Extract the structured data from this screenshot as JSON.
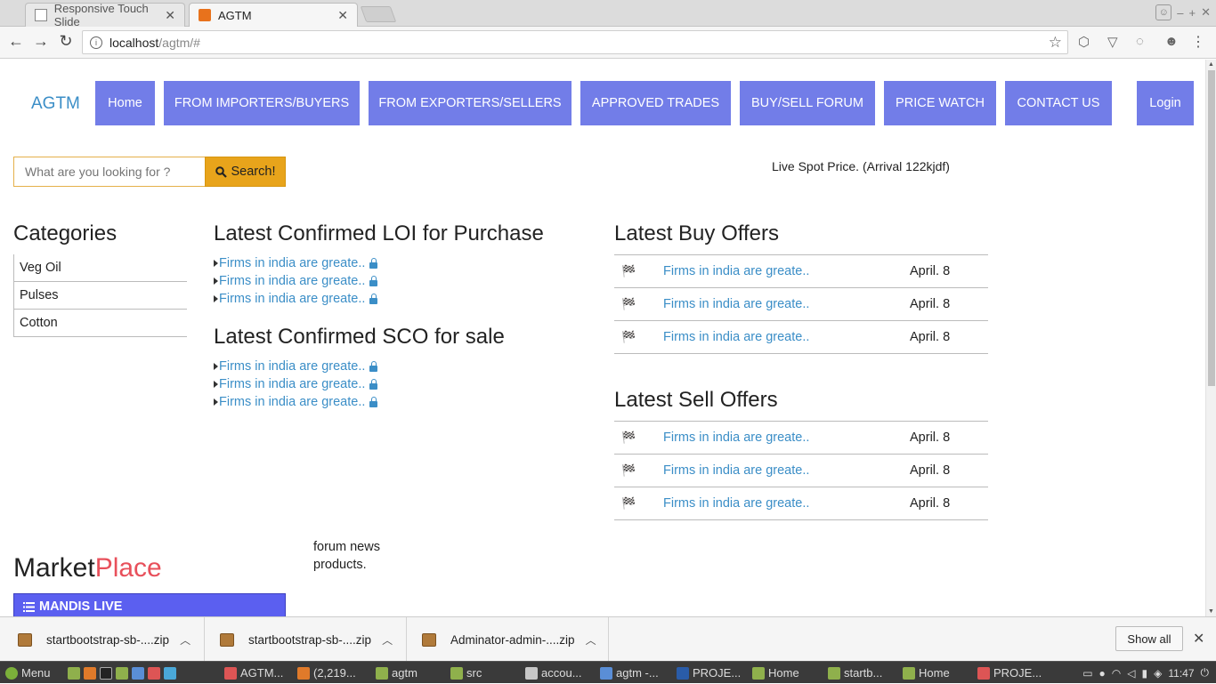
{
  "browser": {
    "tabs": [
      {
        "label": "Responsive Touch Slide",
        "active": false
      },
      {
        "label": "AGTM",
        "active": true
      }
    ],
    "url_host": "localhost",
    "url_path": "/agtm/#"
  },
  "site": {
    "brand": "AGTM",
    "nav": [
      "Home",
      "FROM IMPORTERS/BUYERS",
      "FROM EXPORTERS/SELLERS",
      "APPROVED TRADES",
      "BUY/SELL FORUM",
      "PRICE WATCH",
      "CONTACT US"
    ],
    "login": "Login",
    "search": {
      "placeholder": "What are you looking for ?",
      "button": "Search!"
    },
    "live_price": "Live Spot Price. (Arrival 122kjdf)",
    "categories": {
      "title": "Categories",
      "items": [
        "Veg Oil",
        "Pulses",
        "Cotton"
      ]
    },
    "loi": {
      "title": "Latest Confirmed LOI for Purchase",
      "items": [
        "Firms in india are greate..",
        "Firms in india are greate..",
        "Firms in india are greate.."
      ]
    },
    "sco": {
      "title": "Latest Confirmed SCO for sale",
      "items": [
        "Firms in india are greate..",
        "Firms in india are greate..",
        "Firms in india are greate.."
      ]
    },
    "buy_offers": {
      "title": "Latest Buy Offers",
      "rows": [
        {
          "title": "Firms in india are greate..",
          "date": "April. 8"
        },
        {
          "title": "Firms in india are greate..",
          "date": "April. 8"
        },
        {
          "title": "Firms in india are greate..",
          "date": "April. 8"
        }
      ]
    },
    "sell_offers": {
      "title": "Latest Sell Offers",
      "rows": [
        {
          "title": "Firms in india are greate..",
          "date": "April. 8"
        },
        {
          "title": "Firms in india are greate..",
          "date": "April. 8"
        },
        {
          "title": "Firms in india are greate..",
          "date": "April. 8"
        }
      ]
    },
    "marketplace": {
      "part1": "Market",
      "part2": "Place"
    },
    "forum_news": [
      "forum news",
      "products."
    ],
    "mandis": "MANDIS LIVE"
  },
  "downloads": {
    "items": [
      "startbootstrap-sb-....zip",
      "startbootstrap-sb-....zip",
      "Adminator-admin-....zip"
    ],
    "show_all": "Show all"
  },
  "taskbar": {
    "menu": "Menu",
    "items": [
      "AGTM...",
      "(2,219...",
      "agtm",
      "src",
      "accou...",
      "agtm -...",
      "PROJE...",
      "Home",
      "startb...",
      "Home",
      "PROJE..."
    ],
    "clock": "11:47"
  }
}
